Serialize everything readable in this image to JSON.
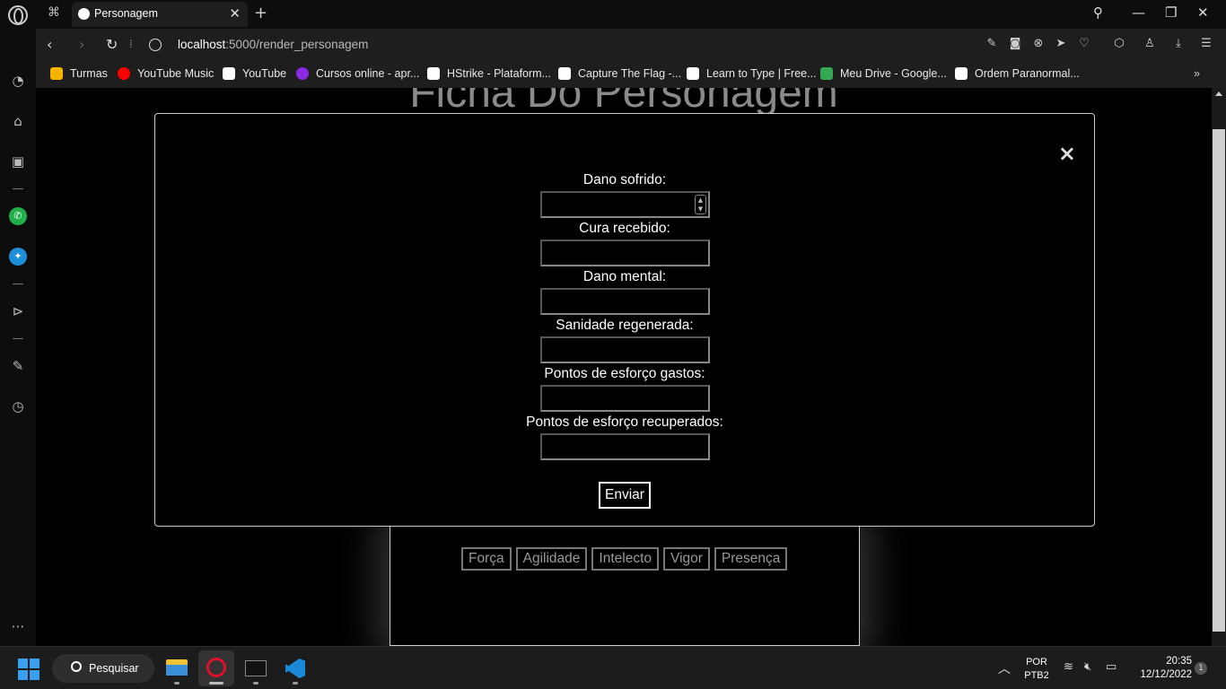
{
  "browser": {
    "tab_title": "Personagem",
    "url_host": "localhost",
    "url_path": ":5000/render_personagem",
    "bookmarks": [
      {
        "label": "Turmas",
        "color": "#f4b400"
      },
      {
        "label": "YouTube Music",
        "color": "#ff0000"
      },
      {
        "label": "YouTube",
        "color": "#ffffff"
      },
      {
        "label": "Cursos online - apr...",
        "color": "#8a2be2"
      },
      {
        "label": "HStrike - Plataform...",
        "color": "#ffffff"
      },
      {
        "label": "Capture The Flag -...",
        "color": "#ffffff"
      },
      {
        "label": "Learn to Type | Free...",
        "color": "#ffffff"
      },
      {
        "label": "Meu Drive - Google...",
        "color": "#34a853"
      },
      {
        "label": "Ordem Paranormal...",
        "color": "#ffffff"
      }
    ]
  },
  "page": {
    "background_title": "Ficha Do Personagem",
    "attributes": [
      "Força",
      "Agilidade",
      "Intelecto",
      "Vigor",
      "Presença"
    ]
  },
  "modal": {
    "close_label": "×",
    "fields": [
      {
        "label": "Dano sofrido:",
        "value": ""
      },
      {
        "label": "Cura recebido:",
        "value": ""
      },
      {
        "label": "Dano mental:",
        "value": ""
      },
      {
        "label": "Sanidade regenerada:",
        "value": ""
      },
      {
        "label": "Pontos de esforço gastos:",
        "value": ""
      },
      {
        "label": "Pontos de esforço recuperados:",
        "value": ""
      }
    ],
    "submit_label": "Enviar"
  },
  "taskbar": {
    "search_label": "Pesquisar",
    "lang_line1": "POR",
    "lang_line2": "PTB2",
    "time": "20:35",
    "date": "12/12/2022",
    "notification_count": "1"
  },
  "colors": {
    "accent_blue": "#3aa0ef",
    "whatsapp": "#22b04b",
    "twitter": "#1d8fd8"
  }
}
